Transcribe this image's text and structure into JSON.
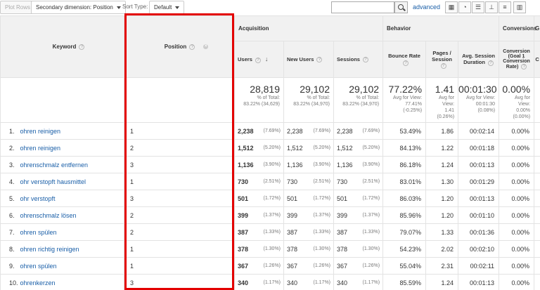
{
  "toolbar": {
    "plot_rows": "Plot Rows",
    "secondary_dimension": "Secondary dimension: Position",
    "sort_type_label": "Sort Type:",
    "sort_type_value": "Default",
    "search_placeholder": "",
    "advanced": "advanced"
  },
  "headers": {
    "keyword": "Keyword",
    "position": "Position",
    "acquisition": "Acquisition",
    "behavior": "Behavior",
    "conversions": "Conversions",
    "users": "Users",
    "new_users": "New Users",
    "sessions": "Sessions",
    "bounce_rate": "Bounce Rate",
    "pages_session": "Pages / Session",
    "avg_session_duration": "Avg. Session Duration",
    "conversion": "Conversion (Goal 1 Conversion Rate)",
    "goal_col_partial": "G",
    "conv2_partial": "C"
  },
  "totals": {
    "users": {
      "value": "28,819",
      "line1": "% of Total:",
      "line2": "83.22% (34,629)"
    },
    "new_users": {
      "value": "29,102",
      "line1": "% of Total:",
      "line2": "83.22% (34,970)"
    },
    "sessions": {
      "value": "29,102",
      "line1": "% of Total:",
      "line2": "83.22% (34,970)"
    },
    "bounce_rate": {
      "value": "77.22%",
      "line1": "Avg for View:",
      "line2": "77.41%",
      "line3": "(-0.25%)"
    },
    "pages_session": {
      "value": "1.41",
      "line1": "Avg for",
      "line2": "View:",
      "line3": "1.41",
      "line4": "(0.26%)"
    },
    "avg_session_duration": {
      "value": "00:01:30",
      "line1": "Avg for View:",
      "line2": "00:01:30",
      "line3": "(0.08%)"
    },
    "conversion": {
      "value": "0.00%",
      "line1": "Avg for",
      "line2": "View:",
      "line3": "0.00%",
      "line4": "(0.00%)"
    }
  },
  "rows": [
    {
      "idx": "1.",
      "keyword": "ohren reinigen",
      "position": "1",
      "users": "2,238",
      "users_pct": "(7.69%)",
      "new_users": "2,238",
      "new_users_pct": "(7.69%)",
      "sessions": "2,238",
      "sessions_pct": "(7.69%)",
      "bounce": "53.49%",
      "pages": "1.86",
      "duration": "00:02:14",
      "conv": "0.00%"
    },
    {
      "idx": "2.",
      "keyword": "ohren reinigen",
      "position": "2",
      "users": "1,512",
      "users_pct": "(5.20%)",
      "new_users": "1,512",
      "new_users_pct": "(5.20%)",
      "sessions": "1,512",
      "sessions_pct": "(5.20%)",
      "bounce": "84.13%",
      "pages": "1.22",
      "duration": "00:01:18",
      "conv": "0.00%"
    },
    {
      "idx": "3.",
      "keyword": "ohrenschmalz entfernen",
      "position": "3",
      "users": "1,136",
      "users_pct": "(3.90%)",
      "new_users": "1,136",
      "new_users_pct": "(3.90%)",
      "sessions": "1,136",
      "sessions_pct": "(3.90%)",
      "bounce": "86.18%",
      "pages": "1.24",
      "duration": "00:01:13",
      "conv": "0.00%"
    },
    {
      "idx": "4.",
      "keyword": "ohr verstopft hausmittel",
      "position": "1",
      "users": "730",
      "users_pct": "(2.51%)",
      "new_users": "730",
      "new_users_pct": "(2.51%)",
      "sessions": "730",
      "sessions_pct": "(2.51%)",
      "bounce": "83.01%",
      "pages": "1.30",
      "duration": "00:01:29",
      "conv": "0.00%"
    },
    {
      "idx": "5.",
      "keyword": "ohr verstopft",
      "position": "3",
      "users": "501",
      "users_pct": "(1.72%)",
      "new_users": "501",
      "new_users_pct": "(1.72%)",
      "sessions": "501",
      "sessions_pct": "(1.72%)",
      "bounce": "86.03%",
      "pages": "1.20",
      "duration": "00:01:13",
      "conv": "0.00%"
    },
    {
      "idx": "6.",
      "keyword": "ohrenschmalz lösen",
      "position": "2",
      "users": "399",
      "users_pct": "(1.37%)",
      "new_users": "399",
      "new_users_pct": "(1.37%)",
      "sessions": "399",
      "sessions_pct": "(1.37%)",
      "bounce": "85.96%",
      "pages": "1.20",
      "duration": "00:01:10",
      "conv": "0.00%"
    },
    {
      "idx": "7.",
      "keyword": "ohren spülen",
      "position": "2",
      "users": "387",
      "users_pct": "(1.33%)",
      "new_users": "387",
      "new_users_pct": "(1.33%)",
      "sessions": "387",
      "sessions_pct": "(1.33%)",
      "bounce": "79.07%",
      "pages": "1.33",
      "duration": "00:01:36",
      "conv": "0.00%"
    },
    {
      "idx": "8.",
      "keyword": "ohren richtig reinigen",
      "position": "1",
      "users": "378",
      "users_pct": "(1.30%)",
      "new_users": "378",
      "new_users_pct": "(1.30%)",
      "sessions": "378",
      "sessions_pct": "(1.30%)",
      "bounce": "54.23%",
      "pages": "2.02",
      "duration": "00:02:10",
      "conv": "0.00%"
    },
    {
      "idx": "9.",
      "keyword": "ohren spülen",
      "position": "1",
      "users": "367",
      "users_pct": "(1.26%)",
      "new_users": "367",
      "new_users_pct": "(1.26%)",
      "sessions": "367",
      "sessions_pct": "(1.26%)",
      "bounce": "55.04%",
      "pages": "2.31",
      "duration": "00:02:11",
      "conv": "0.00%"
    },
    {
      "idx": "10.",
      "keyword": "ohrenkerzen",
      "position": "3",
      "users": "340",
      "users_pct": "(1.17%)",
      "new_users": "340",
      "new_users_pct": "(1.17%)",
      "sessions": "340",
      "sessions_pct": "(1.17%)",
      "bounce": "85.59%",
      "pages": "1.24",
      "duration": "00:01:13",
      "conv": "0.00%"
    }
  ],
  "colors": {
    "link": "#1a5fa8",
    "highlight": "#e30000",
    "header_bg": "#f1f1f1"
  }
}
